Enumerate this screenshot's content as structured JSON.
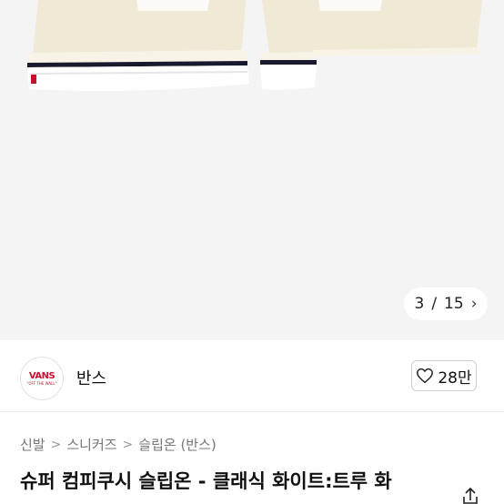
{
  "gallery": {
    "counter_current": "3",
    "counter_sep": "/",
    "counter_total": "15",
    "next_glyph": "›"
  },
  "brand": {
    "logo_text": "VANS",
    "logo_subtext": "\"OFF THE WALL\"",
    "name": "반스"
  },
  "like": {
    "count": "28만"
  },
  "breadcrumb": {
    "items": [
      "신발",
      "스니커즈",
      "슬립온 (반스)"
    ],
    "separator": ">"
  },
  "product": {
    "title": "슈퍼 컴피쿠시 슬립온 - 클래식 화이트:트루 화"
  },
  "colors": {
    "gallery_bg": "#f4f4f4",
    "shoe_canvas": "#efe9d6",
    "sole_white": "#ffffff",
    "sole_stripe": "#1a1a2e",
    "logo_red": "#c8102e"
  },
  "icons": {
    "heart": "heart-icon",
    "share": "share-icon",
    "next": "chevron-right-icon"
  }
}
